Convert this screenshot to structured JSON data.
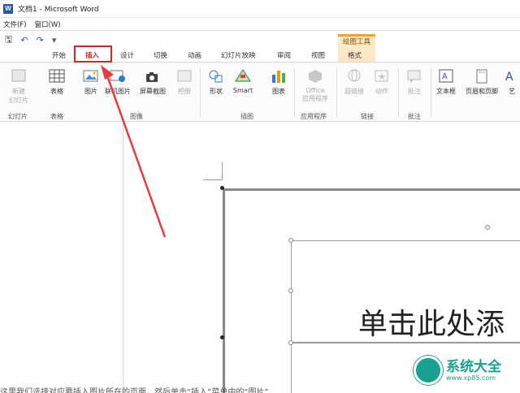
{
  "window": {
    "title": "文档1 - Microsoft Word",
    "app_icon": "W"
  },
  "menu": {
    "file": "文件(F)",
    "window": "窗口(W)"
  },
  "contextual": {
    "title": "绘图工具",
    "tab": "格式"
  },
  "tabs": [
    {
      "label": "开始"
    },
    {
      "label": "插入"
    },
    {
      "label": "设计"
    },
    {
      "label": "切换"
    },
    {
      "label": "动画"
    },
    {
      "label": "幻灯片放映"
    },
    {
      "label": "审阅"
    },
    {
      "label": "视图"
    }
  ],
  "ribbon": {
    "new_slide": "新建\n幻灯片",
    "table": "表格",
    "picture": "图片",
    "online_picture": "联机图片",
    "screenshot": "屏幕截图",
    "album": "相册",
    "shapes": "形状",
    "smartart": "Smart",
    "chart": "图表",
    "office_apps": "Office\n应用程序",
    "hyperlink": "超链接",
    "action": "动作",
    "comment": "批注",
    "textbox": "文本框",
    "header_footer": "页眉和页脚",
    "art": "艺",
    "groups": {
      "slides": "幻灯片",
      "tables": "表格",
      "images": "图像",
      "illustrations": "插图",
      "apps": "应用程序",
      "links": "链接",
      "comments": "批注"
    }
  },
  "slide": {
    "title_placeholder": "单击此处添"
  },
  "watermark": {
    "name": "系统大全",
    "url": "www.xp85.com"
  },
  "caption": "这里我们选择对应要插入图片所在的页面，然后单击“插入”菜单中的“图片”"
}
